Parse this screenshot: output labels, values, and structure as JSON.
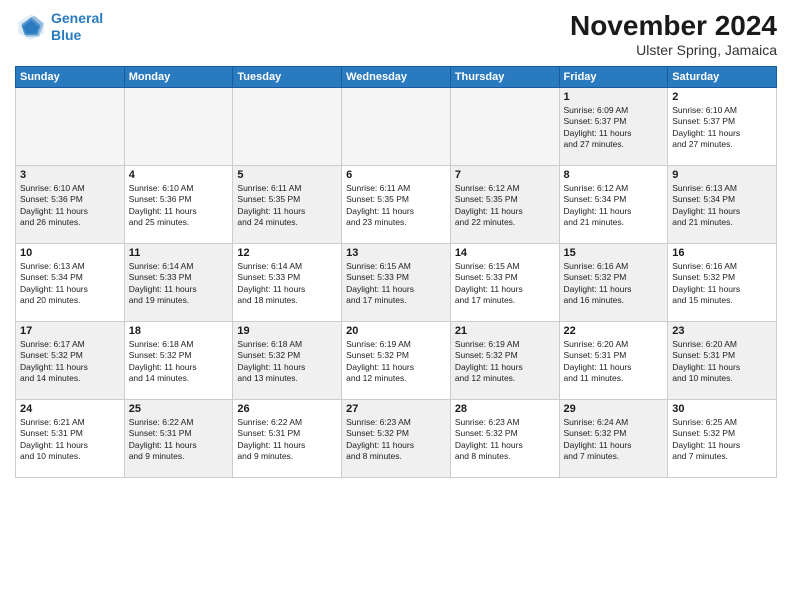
{
  "header": {
    "logo_line1": "General",
    "logo_line2": "Blue",
    "month": "November 2024",
    "location": "Ulster Spring, Jamaica"
  },
  "weekdays": [
    "Sunday",
    "Monday",
    "Tuesday",
    "Wednesday",
    "Thursday",
    "Friday",
    "Saturday"
  ],
  "weeks": [
    [
      {
        "day": "",
        "info": "",
        "empty": true
      },
      {
        "day": "",
        "info": "",
        "empty": true
      },
      {
        "day": "",
        "info": "",
        "empty": true
      },
      {
        "day": "",
        "info": "",
        "empty": true
      },
      {
        "day": "",
        "info": "",
        "empty": true
      },
      {
        "day": "1",
        "info": "Sunrise: 6:09 AM\nSunset: 5:37 PM\nDaylight: 11 hours\nand 27 minutes.",
        "empty": false
      },
      {
        "day": "2",
        "info": "Sunrise: 6:10 AM\nSunset: 5:37 PM\nDaylight: 11 hours\nand 27 minutes.",
        "empty": false
      }
    ],
    [
      {
        "day": "3",
        "info": "Sunrise: 6:10 AM\nSunset: 5:36 PM\nDaylight: 11 hours\nand 26 minutes.",
        "empty": false
      },
      {
        "day": "4",
        "info": "Sunrise: 6:10 AM\nSunset: 5:36 PM\nDaylight: 11 hours\nand 25 minutes.",
        "empty": false
      },
      {
        "day": "5",
        "info": "Sunrise: 6:11 AM\nSunset: 5:35 PM\nDaylight: 11 hours\nand 24 minutes.",
        "empty": false
      },
      {
        "day": "6",
        "info": "Sunrise: 6:11 AM\nSunset: 5:35 PM\nDaylight: 11 hours\nand 23 minutes.",
        "empty": false
      },
      {
        "day": "7",
        "info": "Sunrise: 6:12 AM\nSunset: 5:35 PM\nDaylight: 11 hours\nand 22 minutes.",
        "empty": false
      },
      {
        "day": "8",
        "info": "Sunrise: 6:12 AM\nSunset: 5:34 PM\nDaylight: 11 hours\nand 21 minutes.",
        "empty": false
      },
      {
        "day": "9",
        "info": "Sunrise: 6:13 AM\nSunset: 5:34 PM\nDaylight: 11 hours\nand 21 minutes.",
        "empty": false
      }
    ],
    [
      {
        "day": "10",
        "info": "Sunrise: 6:13 AM\nSunset: 5:34 PM\nDaylight: 11 hours\nand 20 minutes.",
        "empty": false
      },
      {
        "day": "11",
        "info": "Sunrise: 6:14 AM\nSunset: 5:33 PM\nDaylight: 11 hours\nand 19 minutes.",
        "empty": false
      },
      {
        "day": "12",
        "info": "Sunrise: 6:14 AM\nSunset: 5:33 PM\nDaylight: 11 hours\nand 18 minutes.",
        "empty": false
      },
      {
        "day": "13",
        "info": "Sunrise: 6:15 AM\nSunset: 5:33 PM\nDaylight: 11 hours\nand 17 minutes.",
        "empty": false
      },
      {
        "day": "14",
        "info": "Sunrise: 6:15 AM\nSunset: 5:33 PM\nDaylight: 11 hours\nand 17 minutes.",
        "empty": false
      },
      {
        "day": "15",
        "info": "Sunrise: 6:16 AM\nSunset: 5:32 PM\nDaylight: 11 hours\nand 16 minutes.",
        "empty": false
      },
      {
        "day": "16",
        "info": "Sunrise: 6:16 AM\nSunset: 5:32 PM\nDaylight: 11 hours\nand 15 minutes.",
        "empty": false
      }
    ],
    [
      {
        "day": "17",
        "info": "Sunrise: 6:17 AM\nSunset: 5:32 PM\nDaylight: 11 hours\nand 14 minutes.",
        "empty": false
      },
      {
        "day": "18",
        "info": "Sunrise: 6:18 AM\nSunset: 5:32 PM\nDaylight: 11 hours\nand 14 minutes.",
        "empty": false
      },
      {
        "day": "19",
        "info": "Sunrise: 6:18 AM\nSunset: 5:32 PM\nDaylight: 11 hours\nand 13 minutes.",
        "empty": false
      },
      {
        "day": "20",
        "info": "Sunrise: 6:19 AM\nSunset: 5:32 PM\nDaylight: 11 hours\nand 12 minutes.",
        "empty": false
      },
      {
        "day": "21",
        "info": "Sunrise: 6:19 AM\nSunset: 5:32 PM\nDaylight: 11 hours\nand 12 minutes.",
        "empty": false
      },
      {
        "day": "22",
        "info": "Sunrise: 6:20 AM\nSunset: 5:31 PM\nDaylight: 11 hours\nand 11 minutes.",
        "empty": false
      },
      {
        "day": "23",
        "info": "Sunrise: 6:20 AM\nSunset: 5:31 PM\nDaylight: 11 hours\nand 10 minutes.",
        "empty": false
      }
    ],
    [
      {
        "day": "24",
        "info": "Sunrise: 6:21 AM\nSunset: 5:31 PM\nDaylight: 11 hours\nand 10 minutes.",
        "empty": false
      },
      {
        "day": "25",
        "info": "Sunrise: 6:22 AM\nSunset: 5:31 PM\nDaylight: 11 hours\nand 9 minutes.",
        "empty": false
      },
      {
        "day": "26",
        "info": "Sunrise: 6:22 AM\nSunset: 5:31 PM\nDaylight: 11 hours\nand 9 minutes.",
        "empty": false
      },
      {
        "day": "27",
        "info": "Sunrise: 6:23 AM\nSunset: 5:32 PM\nDaylight: 11 hours\nand 8 minutes.",
        "empty": false
      },
      {
        "day": "28",
        "info": "Sunrise: 6:23 AM\nSunset: 5:32 PM\nDaylight: 11 hours\nand 8 minutes.",
        "empty": false
      },
      {
        "day": "29",
        "info": "Sunrise: 6:24 AM\nSunset: 5:32 PM\nDaylight: 11 hours\nand 7 minutes.",
        "empty": false
      },
      {
        "day": "30",
        "info": "Sunrise: 6:25 AM\nSunset: 5:32 PM\nDaylight: 11 hours\nand 7 minutes.",
        "empty": false
      }
    ]
  ]
}
